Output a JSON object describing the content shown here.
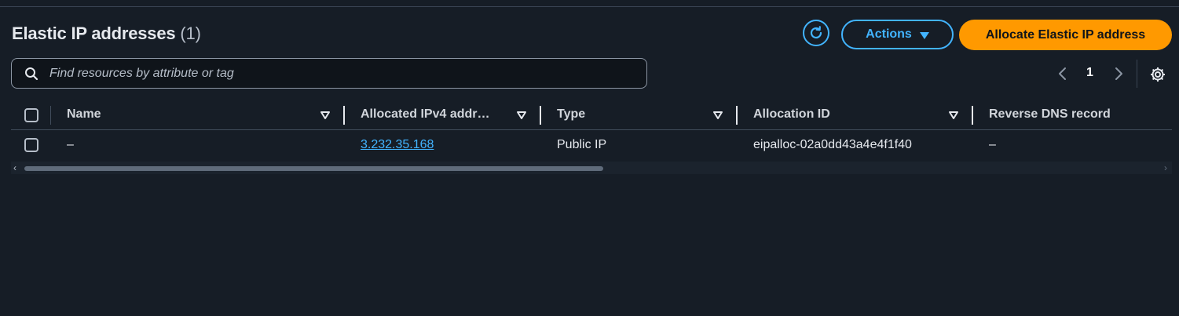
{
  "header": {
    "title": "Elastic IP addresses",
    "count": "(1)",
    "actions_label": "Actions",
    "allocate_label": "Allocate Elastic IP address"
  },
  "search": {
    "placeholder": "Find resources by attribute or tag"
  },
  "pagination": {
    "current_page": "1"
  },
  "table": {
    "columns": [
      "Name",
      "Allocated IPv4 addr…",
      "Type",
      "Allocation ID",
      "Reverse DNS record"
    ],
    "rows": [
      {
        "name": "–",
        "ipv4": "3.232.35.168",
        "type": "Public IP",
        "allocation_id": "eipalloc-02a0dd43a4e4f1f40",
        "reverse_dns": "–"
      }
    ]
  },
  "colors": {
    "background": "#161d26",
    "accent_blue": "#42b4ff",
    "primary_orange": "#ff9900"
  },
  "icons": [
    "refresh-icon",
    "caret-down-icon",
    "search-icon",
    "chevron-left-icon",
    "chevron-right-icon",
    "gear-icon",
    "sort-icon"
  ]
}
